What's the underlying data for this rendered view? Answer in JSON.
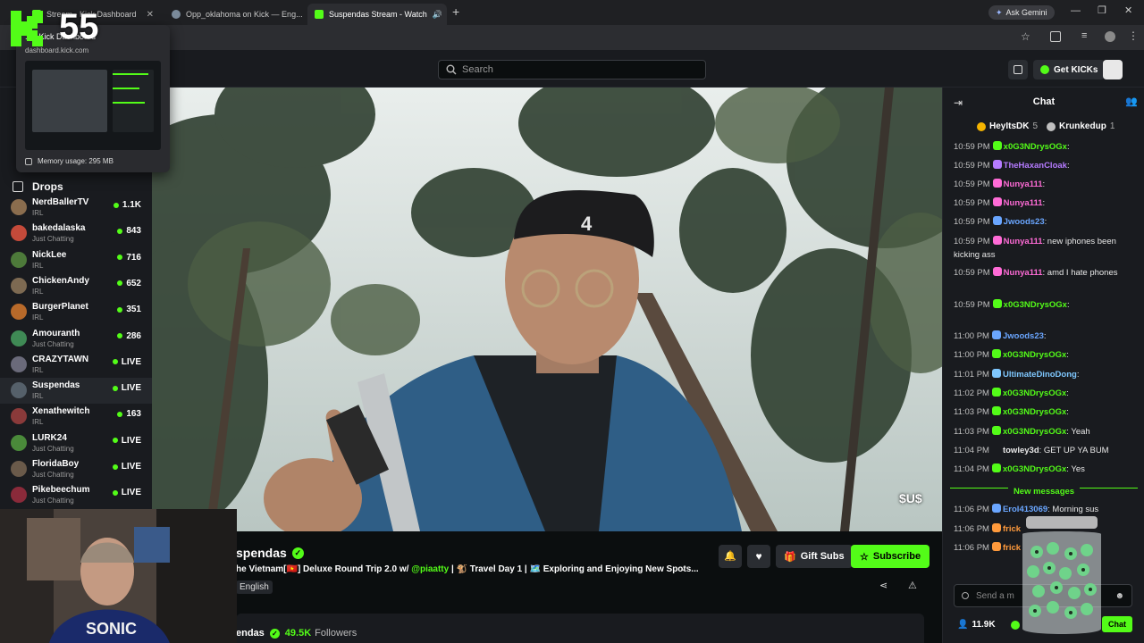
{
  "browser": {
    "tabs": [
      {
        "title": "Stream - Kick Dashboard",
        "active": false
      },
      {
        "title": "Opp_oklahoma on Kick — Eng...",
        "active": false
      },
      {
        "title": "Suspendas Stream - Watch",
        "active": true
      }
    ],
    "new_tab": "+",
    "ask_gemini": "Ask Gemini"
  },
  "tab_tooltip": {
    "title": "... - Kick Dashboard",
    "domain": "dashboard.kick.com",
    "memory": "Memory usage: 295 MB"
  },
  "overlay_counter": "55",
  "header": {
    "search_placeholder": "Search",
    "get_kicks": "Get KICKs"
  },
  "sidebar": {
    "drops_label": "Drops",
    "channels": [
      {
        "name": "NerdBallerTV",
        "category": "IRL",
        "viewers": "1.1K",
        "color": "#8a6d4e"
      },
      {
        "name": "bakedalaska",
        "category": "Just Chatting",
        "viewers": "843",
        "color": "#c44a3a"
      },
      {
        "name": "NickLee",
        "category": "IRL",
        "viewers": "716",
        "color": "#4d7a3a"
      },
      {
        "name": "ChickenAndy",
        "category": "IRL",
        "viewers": "652",
        "color": "#7d6a52"
      },
      {
        "name": "BurgerPlanet",
        "category": "IRL",
        "viewers": "351",
        "color": "#b86a2a"
      },
      {
        "name": "Amouranth",
        "category": "Just Chatting",
        "viewers": "286",
        "color": "#3f8a55"
      },
      {
        "name": "CRAZYTAWN",
        "category": "IRL",
        "viewers": "LIVE",
        "color": "#6a6a7a"
      },
      {
        "name": "Suspendas",
        "category": "IRL",
        "viewers": "LIVE",
        "color": "#55606a"
      },
      {
        "name": "Xenathewitch",
        "category": "IRL",
        "viewers": "163",
        "color": "#8a3a3a"
      },
      {
        "name": "LURK24",
        "category": "Just Chatting",
        "viewers": "LIVE",
        "color": "#4a8a3a"
      },
      {
        "name": "FloridaBoy",
        "category": "Just Chatting",
        "viewers": "LIVE",
        "color": "#6a5a4a"
      },
      {
        "name": "Pikebeechum",
        "category": "Just Chatting",
        "viewers": "LIVE",
        "color": "#8a2a3a"
      }
    ]
  },
  "stream": {
    "channel": "Suspendas",
    "channel_partial": "spendas",
    "title": "he Vietnam[🇻🇳] Deluxe Round Trip 2.0 w/",
    "mention": "@piaatty",
    "title_rest": "| 🐒 Travel Day 1 | 🗺️ Exploring and Enjoying New Spots...",
    "language": "English",
    "gift_subs": "Gift Subs",
    "subscribe": "Subscribe",
    "followers_count": "49.5K",
    "followers_label": "Followers",
    "about_name": "endas",
    "watermark": "$U$"
  },
  "chat": {
    "title": "Chat",
    "top_gifters": [
      {
        "name": "HeyItsDK",
        "count": "5"
      },
      {
        "name": "Krunkedup",
        "count": "1"
      }
    ],
    "messages": [
      {
        "time": "10:59 PM",
        "user": "x0G3NDrysOGx",
        "color": "#53fc18",
        "text": ":"
      },
      {
        "time": "10:59 PM",
        "user": "TheHaxanCloak",
        "color": "#b57bff",
        "text": ":"
      },
      {
        "time": "10:59 PM",
        "user": "Nunya111",
        "color": "#ff6bd6",
        "text": ":"
      },
      {
        "time": "10:59 PM",
        "user": "Nunya111",
        "color": "#ff6bd6",
        "text": ":"
      },
      {
        "time": "10:59 PM",
        "user": "Jwoods23",
        "color": "#6aa6ff",
        "text": ":"
      },
      {
        "time": "10:59 PM",
        "user": "Nunya111",
        "color": "#ff6bd6",
        "text": ": new iphones been kicking ass"
      },
      {
        "time": "10:59 PM",
        "user": "Nunya111",
        "color": "#ff6bd6",
        "text": ": amd I hate phones"
      },
      {
        "time": "10:59 PM",
        "user": "x0G3NDrysOGx",
        "color": "#53fc18",
        "text": ":"
      },
      {
        "time": "11:00 PM",
        "user": "Jwoods23",
        "color": "#6aa6ff",
        "text": ":"
      },
      {
        "time": "11:00 PM",
        "user": "x0G3NDrysOGx",
        "color": "#53fc18",
        "text": ":"
      },
      {
        "time": "11:01 PM",
        "user": "UltimateDinoDong",
        "color": "#7fc8ff",
        "text": ":"
      },
      {
        "time": "11:02 PM",
        "user": "x0G3NDrysOGx",
        "color": "#53fc18",
        "text": ":"
      },
      {
        "time": "11:03 PM",
        "user": "x0G3NDrysOGx",
        "color": "#53fc18",
        "text": ":"
      },
      {
        "time": "11:03 PM",
        "user": "x0G3NDrysOGx",
        "color": "#53fc18",
        "text": ": Yeah"
      },
      {
        "time": "11:04 PM",
        "user": "towley3d",
        "color": "#e8e8e8",
        "text": ": GET UP YA BUM"
      },
      {
        "time": "11:04 PM",
        "user": "x0G3NDrysOGx",
        "color": "#53fc18",
        "text": ": Yes"
      }
    ],
    "new_messages": "New messages",
    "new": [
      {
        "time": "11:06 PM",
        "user": "Erol413069",
        "color": "#6aa6ff",
        "text": ": Morning sus"
      },
      {
        "time": "11:06 PM",
        "user": "frick",
        "color": "#ff9a3c",
        "text": ""
      },
      {
        "time": "11:06 PM",
        "user": "frick",
        "color": "#ff9a3c",
        "text": ""
      }
    ],
    "input_placeholder": "Send a m",
    "viewer_count": "11.9K",
    "chat_button": "Chat"
  },
  "colors": {
    "kick_green": "#53fc18",
    "bg": "#0b0e0f",
    "panel": "#191b1f"
  }
}
